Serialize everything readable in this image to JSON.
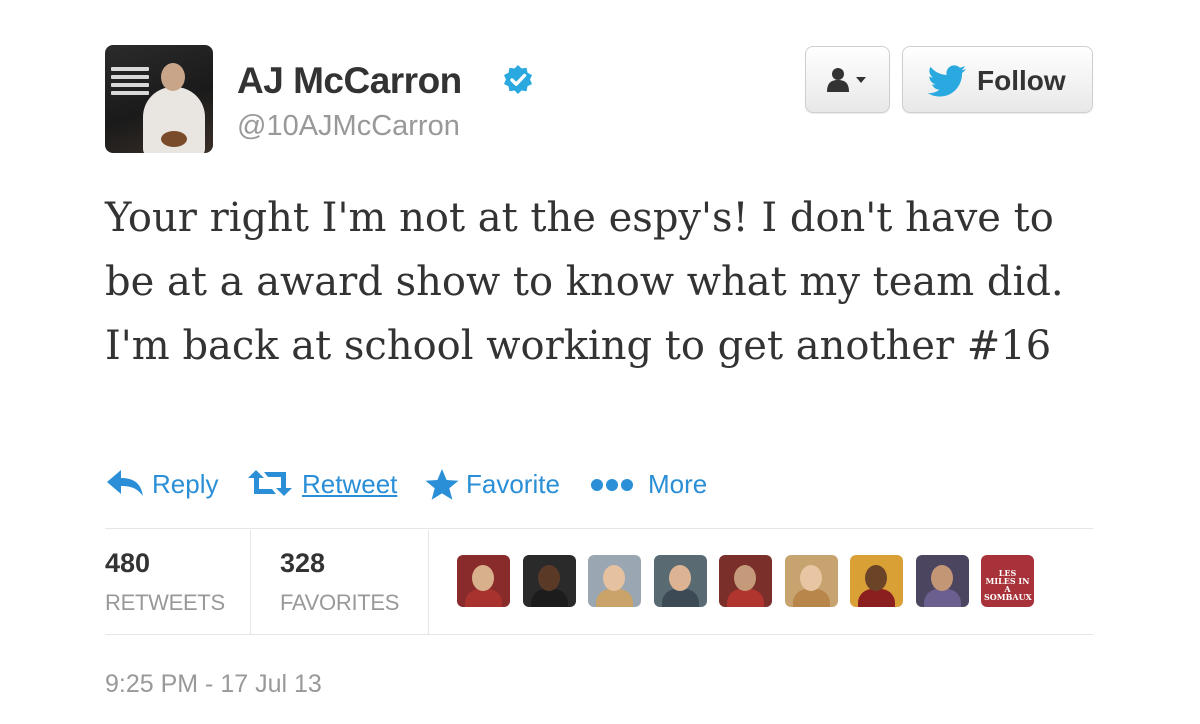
{
  "tweet": {
    "author_name": "AJ McCarron",
    "handle": "@10AJMcCarron",
    "verified": true,
    "text": "Your right I'm not at the espy's! I don't have to be at a award show to know what my team did. I'm back at school working to get another #16",
    "timestamp": "9:25 PM - 17 Jul 13"
  },
  "header_buttons": {
    "user_actions_icon": "user-dropdown-icon",
    "follow_label": "Follow",
    "follow_icon": "twitter-bird-icon"
  },
  "actions": {
    "reply": "Reply",
    "retweet": "Retweet",
    "favorite": "Favorite",
    "more": "More"
  },
  "stats": {
    "retweets": {
      "count": "480",
      "label": "RETWEETS"
    },
    "favorites": {
      "count": "328",
      "label": "FAVORITES"
    }
  },
  "favorited_by": [
    {
      "name": "face-avatar",
      "bg": "#8a2b2b",
      "skin": "#d9b08c",
      "body": "#a8322e"
    },
    {
      "name": "face-avatar",
      "bg": "#2a2a2a",
      "skin": "#5a3a26",
      "body": "#1c1c1c"
    },
    {
      "name": "face-avatar",
      "bg": "#9aa7b3",
      "skin": "#e5c1a0",
      "body": "#c9a36a"
    },
    {
      "name": "face-avatar",
      "bg": "#5a6a72",
      "skin": "#dcb493",
      "body": "#3b4a55"
    },
    {
      "name": "face-avatar",
      "bg": "#7a2f2a",
      "skin": "#c49a7a",
      "body": "#b0352e"
    },
    {
      "name": "face-avatar",
      "bg": "#c7a36f",
      "skin": "#e8c6a3",
      "body": "#b8864a"
    },
    {
      "name": "face-avatar",
      "bg": "#d9a035",
      "skin": "#6b4428",
      "body": "#8b1e1e"
    },
    {
      "name": "face-avatar",
      "bg": "#4b4560",
      "skin": "#c39776",
      "body": "#6b5f8f"
    },
    {
      "name": "sign-avatar",
      "bg": "#a8323a",
      "text": "LES MILES IN A SOMBAUX"
    }
  ],
  "colors": {
    "link_blue": "#2a8fd6",
    "verified_blue": "#2aa9e0",
    "text_dark": "#333333",
    "text_muted": "#999999"
  }
}
